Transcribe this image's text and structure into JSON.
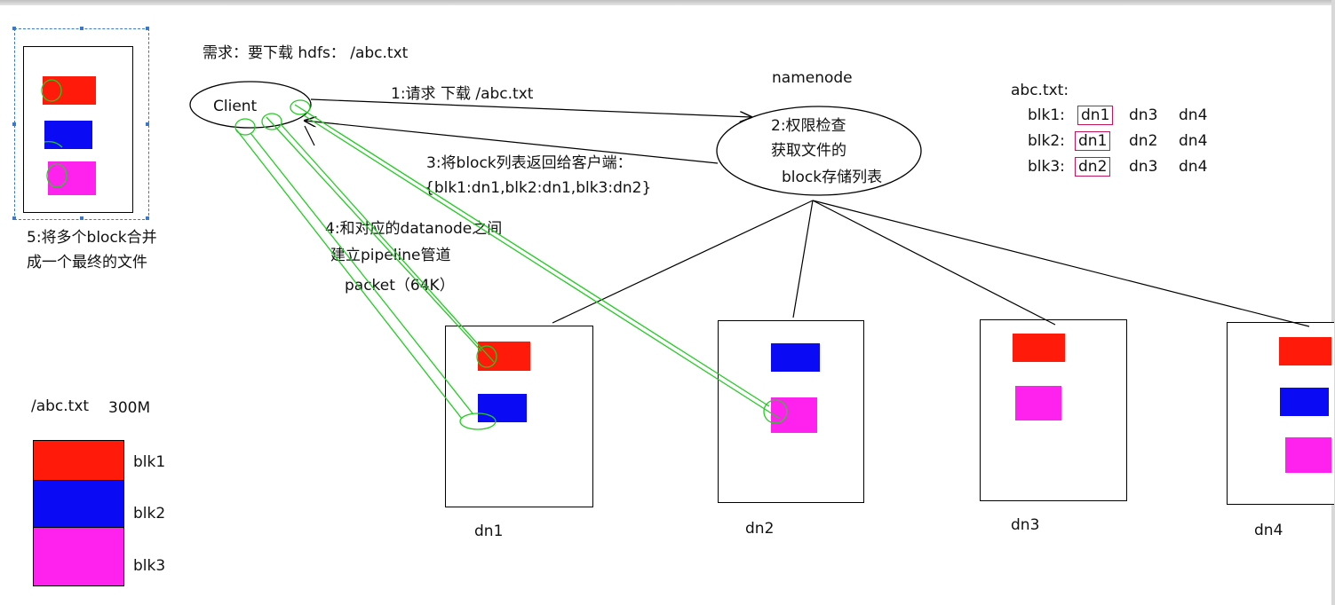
{
  "colors": {
    "blk1": "#ff1a0a",
    "blk2": "#0a0af5",
    "blk3": "#ff22ee",
    "annot": "#22cc22",
    "mark": "#c2185b"
  },
  "title": "需求：要下载 hdfs： /abc.txt",
  "client": {
    "label": "Client"
  },
  "namenode": {
    "label": "namenode",
    "bubble_lines": [
      "2:权限检查",
      "获取文件的",
      "block存储列表"
    ]
  },
  "steps": {
    "step1": "1:请求 下载  /abc.txt",
    "step3_line1": "3:将block列表返回给客户端：",
    "step3_line2": "{blk1:dn1,blk2:dn1,blk3:dn2}",
    "step4_line1": "4:和对应的datanode之间",
    "step4_line2": "建立pipeline管道",
    "step4_line3": "packet（64K）",
    "step5_line1": "5:将多个block合并",
    "step5_line2": "成一个最终的文件"
  },
  "metadata": {
    "file": "abc.txt:",
    "rows": [
      {
        "blk": "blk1:",
        "dns": [
          "dn1",
          "dn3",
          "dn4"
        ]
      },
      {
        "blk": "blk2:",
        "dns": [
          "dn1",
          "dn2",
          "dn4"
        ]
      },
      {
        "blk": "blk3:",
        "dns": [
          "dn2",
          "dn3",
          "dn4"
        ]
      }
    ]
  },
  "file": {
    "name": "/abc.txt",
    "size": "300M",
    "blocks": [
      "blk1",
      "blk2",
      "blk3"
    ]
  },
  "datanodes": [
    "dn1",
    "dn2",
    "dn3",
    "dn4"
  ]
}
